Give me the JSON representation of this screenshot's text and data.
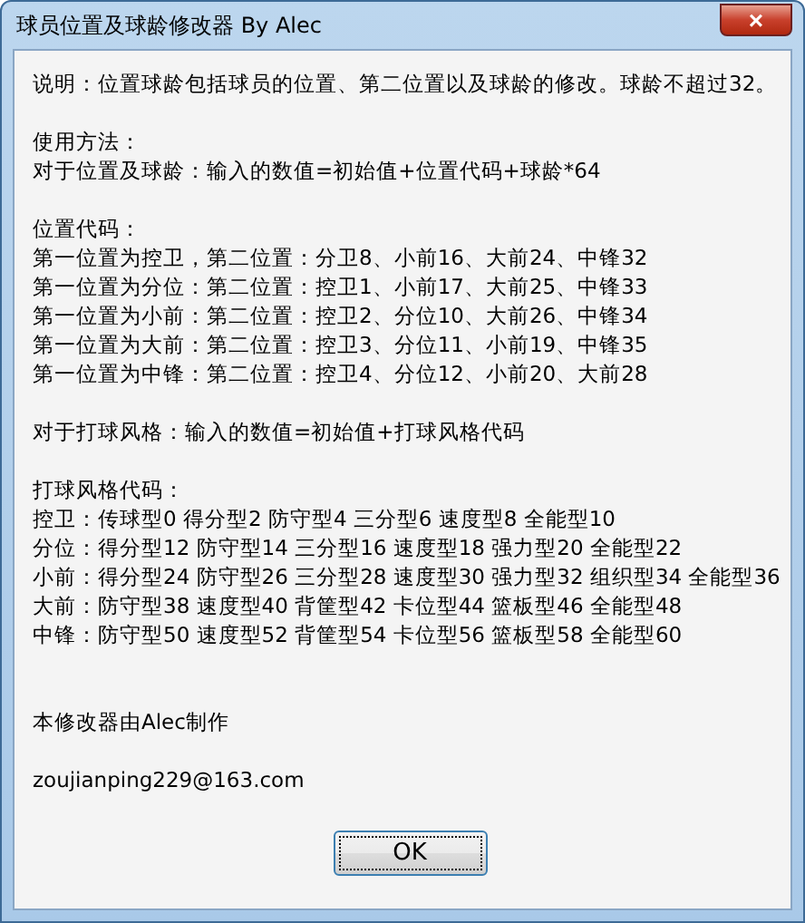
{
  "window": {
    "title": "球员位置及球龄修改器 By Alec",
    "close": "×"
  },
  "sections": [
    {
      "lines": [
        "说明：位置球龄包括球员的位置、第二位置以及球龄的修改。球龄不超过32。"
      ]
    },
    {
      "lines": [
        "使用方法：",
        "对于位置及球龄：输入的数值=初始值+位置代码+球龄*64"
      ]
    },
    {
      "lines": [
        "位置代码：",
        "第一位置为控卫，第二位置：分卫8、小前16、大前24、中锋32",
        "第一位置为分位：第二位置：控卫1、小前17、大前25、中锋33",
        "第一位置为小前：第二位置：控卫2、分位10、大前26、中锋34",
        "第一位置为大前：第二位置：控卫3、分位11、小前19、中锋35",
        "第一位置为中锋：第二位置：控卫4、分位12、小前20、大前28"
      ]
    },
    {
      "lines": [
        "对于打球风格：输入的数值=初始值+打球风格代码"
      ]
    },
    {
      "lines": [
        "打球风格代码：",
        "控卫：传球型0 得分型2 防守型4 三分型6 速度型8 全能型10",
        "分位：得分型12 防守型14 三分型16 速度型18 强力型20 全能型22",
        "小前：得分型24 防守型26 三分型28 速度型30 强力型32 组织型34 全能型36",
        "大前：防守型38 速度型40 背筐型42 卡位型44 篮板型46 全能型48",
        "中锋：防守型50 速度型52 背筐型54 卡位型56 篮板型58 全能型60"
      ]
    }
  ],
  "footer": [
    {
      "lines": [
        "本修改器由Alec制作"
      ]
    },
    {
      "lines": [
        "zoujianping229@163.com"
      ]
    }
  ],
  "buttons": [
    "OK"
  ]
}
